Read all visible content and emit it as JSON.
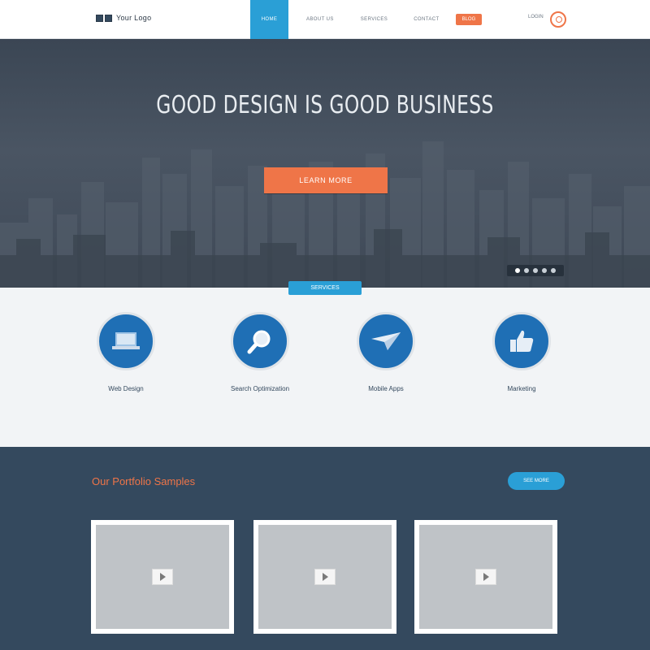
{
  "header": {
    "logo_text": "Your Logo",
    "nav": [
      "Home",
      "About Us",
      "Services",
      "Contact",
      "Blog"
    ],
    "login": "Login"
  },
  "hero": {
    "title": "GOOD DESIGN IS GOOD BUSINESS",
    "subtitle": "",
    "cta": "Learn More",
    "slide_count": 5,
    "active_slide": 0
  },
  "features": {
    "tag": "Services",
    "items": [
      {
        "title": "Web Design",
        "desc": "",
        "icon": "laptop-icon"
      },
      {
        "title": "Search Optimization",
        "desc": "",
        "icon": "magnifier-icon"
      },
      {
        "title": "Mobile Apps",
        "desc": "",
        "icon": "airplane-icon"
      },
      {
        "title": "Marketing",
        "desc": "",
        "icon": "thumbs-up-icon"
      }
    ]
  },
  "portfolio": {
    "title": "Our Portfolio Samples",
    "button": "See More",
    "cards": [
      {
        "caption": ""
      },
      {
        "caption": ""
      },
      {
        "caption": ""
      }
    ]
  },
  "colors": {
    "accent_orange": "#ef7548",
    "accent_blue": "#2a9fd6",
    "dark_navy": "#34495e",
    "icon_blue": "#1f6fb5"
  }
}
